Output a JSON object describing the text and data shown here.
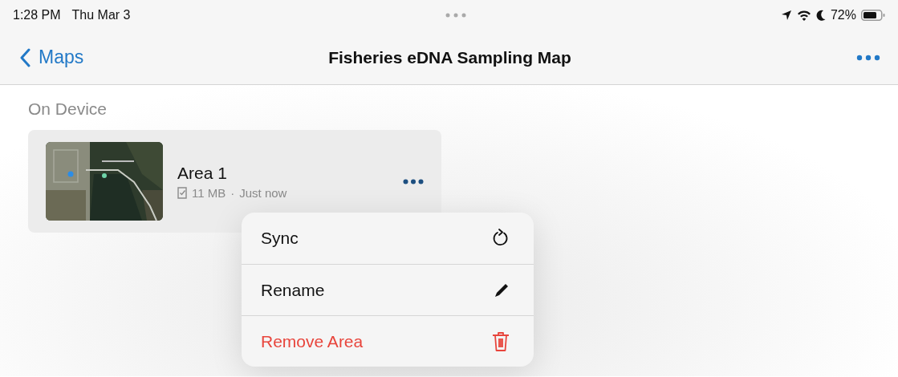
{
  "status_bar": {
    "time": "1:28 PM",
    "date": "Thu Mar 3",
    "battery": "72%"
  },
  "nav_bar": {
    "back": "Maps",
    "title": "Fisheries eDNA Sampling Map"
  },
  "section": {
    "title": "On Device"
  },
  "area": {
    "kind": "picture",
    "name": "Area 1",
    "size": "11 MB",
    "separator": "·",
    "updated": "Just now"
  },
  "menu": [
    {
      "label": "Sync",
      "destructive": false
    },
    {
      "label": "Rename",
      "destructive": false
    },
    {
      "label": "Remove Area",
      "destructive": true
    }
  ]
}
